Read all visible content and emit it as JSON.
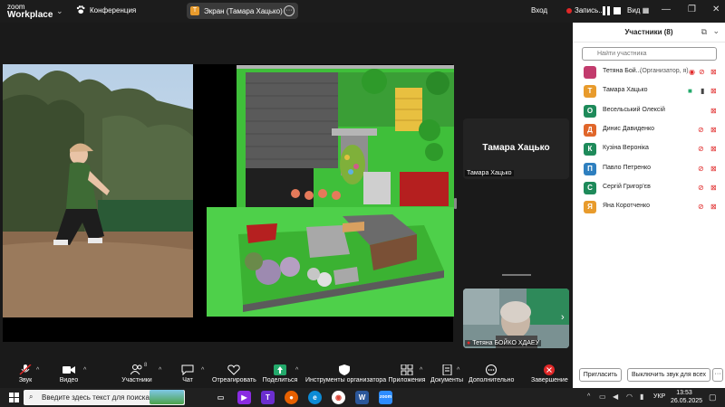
{
  "titlebar": {
    "logo_line1": "zoom",
    "logo_line2": "Workplace",
    "meeting_label": "Конференция",
    "share_avatar_letter": "Т",
    "share_label": "Экран (Тамара Хацько)",
    "login": "Вход",
    "recording_label": "Запись...",
    "view_label": "Вид"
  },
  "stage": {
    "speaker_tile_big_name": "Тамара Хацько",
    "speaker_tile_small_name": "Тамара Хацько",
    "video_tile_name": "Тетяна БОЙКО ХДАЕУ"
  },
  "panel": {
    "title": "Участники (8)",
    "search_placeholder": "Найти участника",
    "participants": [
      {
        "name": "Тетяна Бой...",
        "role": "(Организатор, я)",
        "letter": "",
        "color": "#c23b6d",
        "video": "off"
      },
      {
        "name": "Тамара Хацько",
        "role": "",
        "letter": "Т",
        "color": "#e89b2c",
        "video": "on"
      },
      {
        "name": "Весельський Олексій",
        "role": "",
        "letter": "О",
        "color": "#1e8a5a",
        "video": "none"
      },
      {
        "name": "Динис Давиденко",
        "role": "",
        "letter": "Д",
        "color": "#e0662a",
        "video": "off"
      },
      {
        "name": "Кузіна Вероніка",
        "role": "",
        "letter": "К",
        "color": "#1e8a5a",
        "video": "off"
      },
      {
        "name": "Павло Петренко",
        "role": "",
        "letter": "П",
        "color": "#2e7fbf",
        "video": "off"
      },
      {
        "name": "Сергій Григор'єв",
        "role": "",
        "letter": "С",
        "color": "#1e8a5a",
        "video": "off"
      },
      {
        "name": "Яна Коротченко",
        "role": "",
        "letter": "Я",
        "color": "#e89b2c",
        "video": "off"
      }
    ],
    "invite_label": "Пригласить",
    "mute_all_label": "Выключить звук для всех",
    "more_label": "···"
  },
  "toolbar": {
    "audio": "Звук",
    "video": "Видео",
    "participants": "Участники",
    "participants_count": "8",
    "chat": "Чат",
    "react": "Отреагировать",
    "share": "Поделиться",
    "host_tools": "Инструменты организатора",
    "apps": "Приложения",
    "docs": "Документы",
    "more": "Дополнительно",
    "end": "Завершение"
  },
  "taskbar": {
    "search_placeholder": "Введите здесь текст для поиска",
    "lang": "УКР",
    "time": "13:53",
    "date": "26.05.2025"
  },
  "colors": {
    "accent_green": "#23a96b",
    "danger_red": "#e02828",
    "bg_dark": "#1a1a1a"
  }
}
